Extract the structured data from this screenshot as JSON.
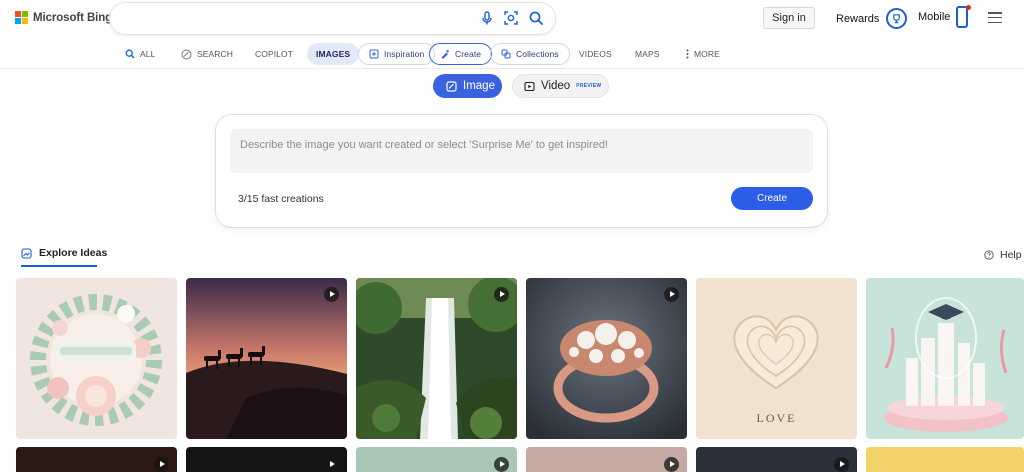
{
  "header": {
    "logo_text": "Microsoft Bing",
    "search_value": "",
    "icons": [
      "mic-icon",
      "visual-search-icon",
      "search-icon"
    ],
    "sign_in_label": "Sign in",
    "rewards_label": "Rewards",
    "mobile_label": "Mobile"
  },
  "nav": {
    "items": [
      {
        "label": "ALL",
        "icon": "search-icon"
      },
      {
        "label": "SEARCH",
        "icon": "copilot-search-icon"
      },
      {
        "label": "COPILOT",
        "icon": ""
      },
      {
        "label": "IMAGES",
        "active": true
      },
      {
        "label": "Inspiration",
        "icon": "inspiration-icon"
      },
      {
        "label": "Create",
        "icon": "create-icon",
        "selected": true
      },
      {
        "label": "Collections",
        "icon": "collections-icon"
      },
      {
        "label": "VIDEOS"
      },
      {
        "label": "MAPS"
      },
      {
        "label": "MORE",
        "icon": "more-icon"
      }
    ]
  },
  "mode": {
    "image_label": "Image",
    "video_label": "Video",
    "video_tag": "PREVIEW",
    "selected": "Image"
  },
  "create_panel": {
    "placeholder": "Describe the image you want created or select 'Surprise Me' to get inspired!",
    "value": "",
    "counter": "3/15 fast creations",
    "button_label": "Create"
  },
  "explore": {
    "tab_label": "Explore Ideas",
    "help_label": "Help",
    "tiles": [
      {
        "subject": "paper-art summer wreath",
        "has_video": false
      },
      {
        "subject": "camel caravan desert sunset",
        "has_video": true
      },
      {
        "subject": "forest waterfall",
        "has_video": true
      },
      {
        "subject": "rose gold pearl ring",
        "has_video": true
      },
      {
        "subject": "paper quilled heart",
        "caption": "LOVE",
        "has_video": false
      },
      {
        "subject": "pastel paper city with graduation cap",
        "has_video": false
      }
    ]
  },
  "colors": {
    "accent": "#2b5de6",
    "nav_active_bg": "#e3e9f9",
    "rewards_blue": "#1a5fd6"
  }
}
